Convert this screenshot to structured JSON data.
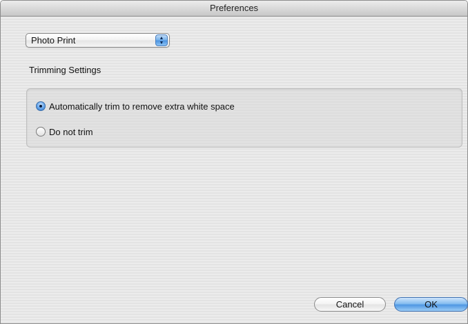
{
  "window": {
    "title": "Preferences"
  },
  "popup": {
    "selected": "Photo Print",
    "arrows": "▲▼"
  },
  "trimming": {
    "section_label": "Trimming Settings",
    "options": [
      {
        "label": "Automatically trim to remove extra white space",
        "selected": true
      },
      {
        "label": "Do not trim",
        "selected": false
      }
    ]
  },
  "buttons": {
    "cancel": "Cancel",
    "ok": "OK"
  }
}
